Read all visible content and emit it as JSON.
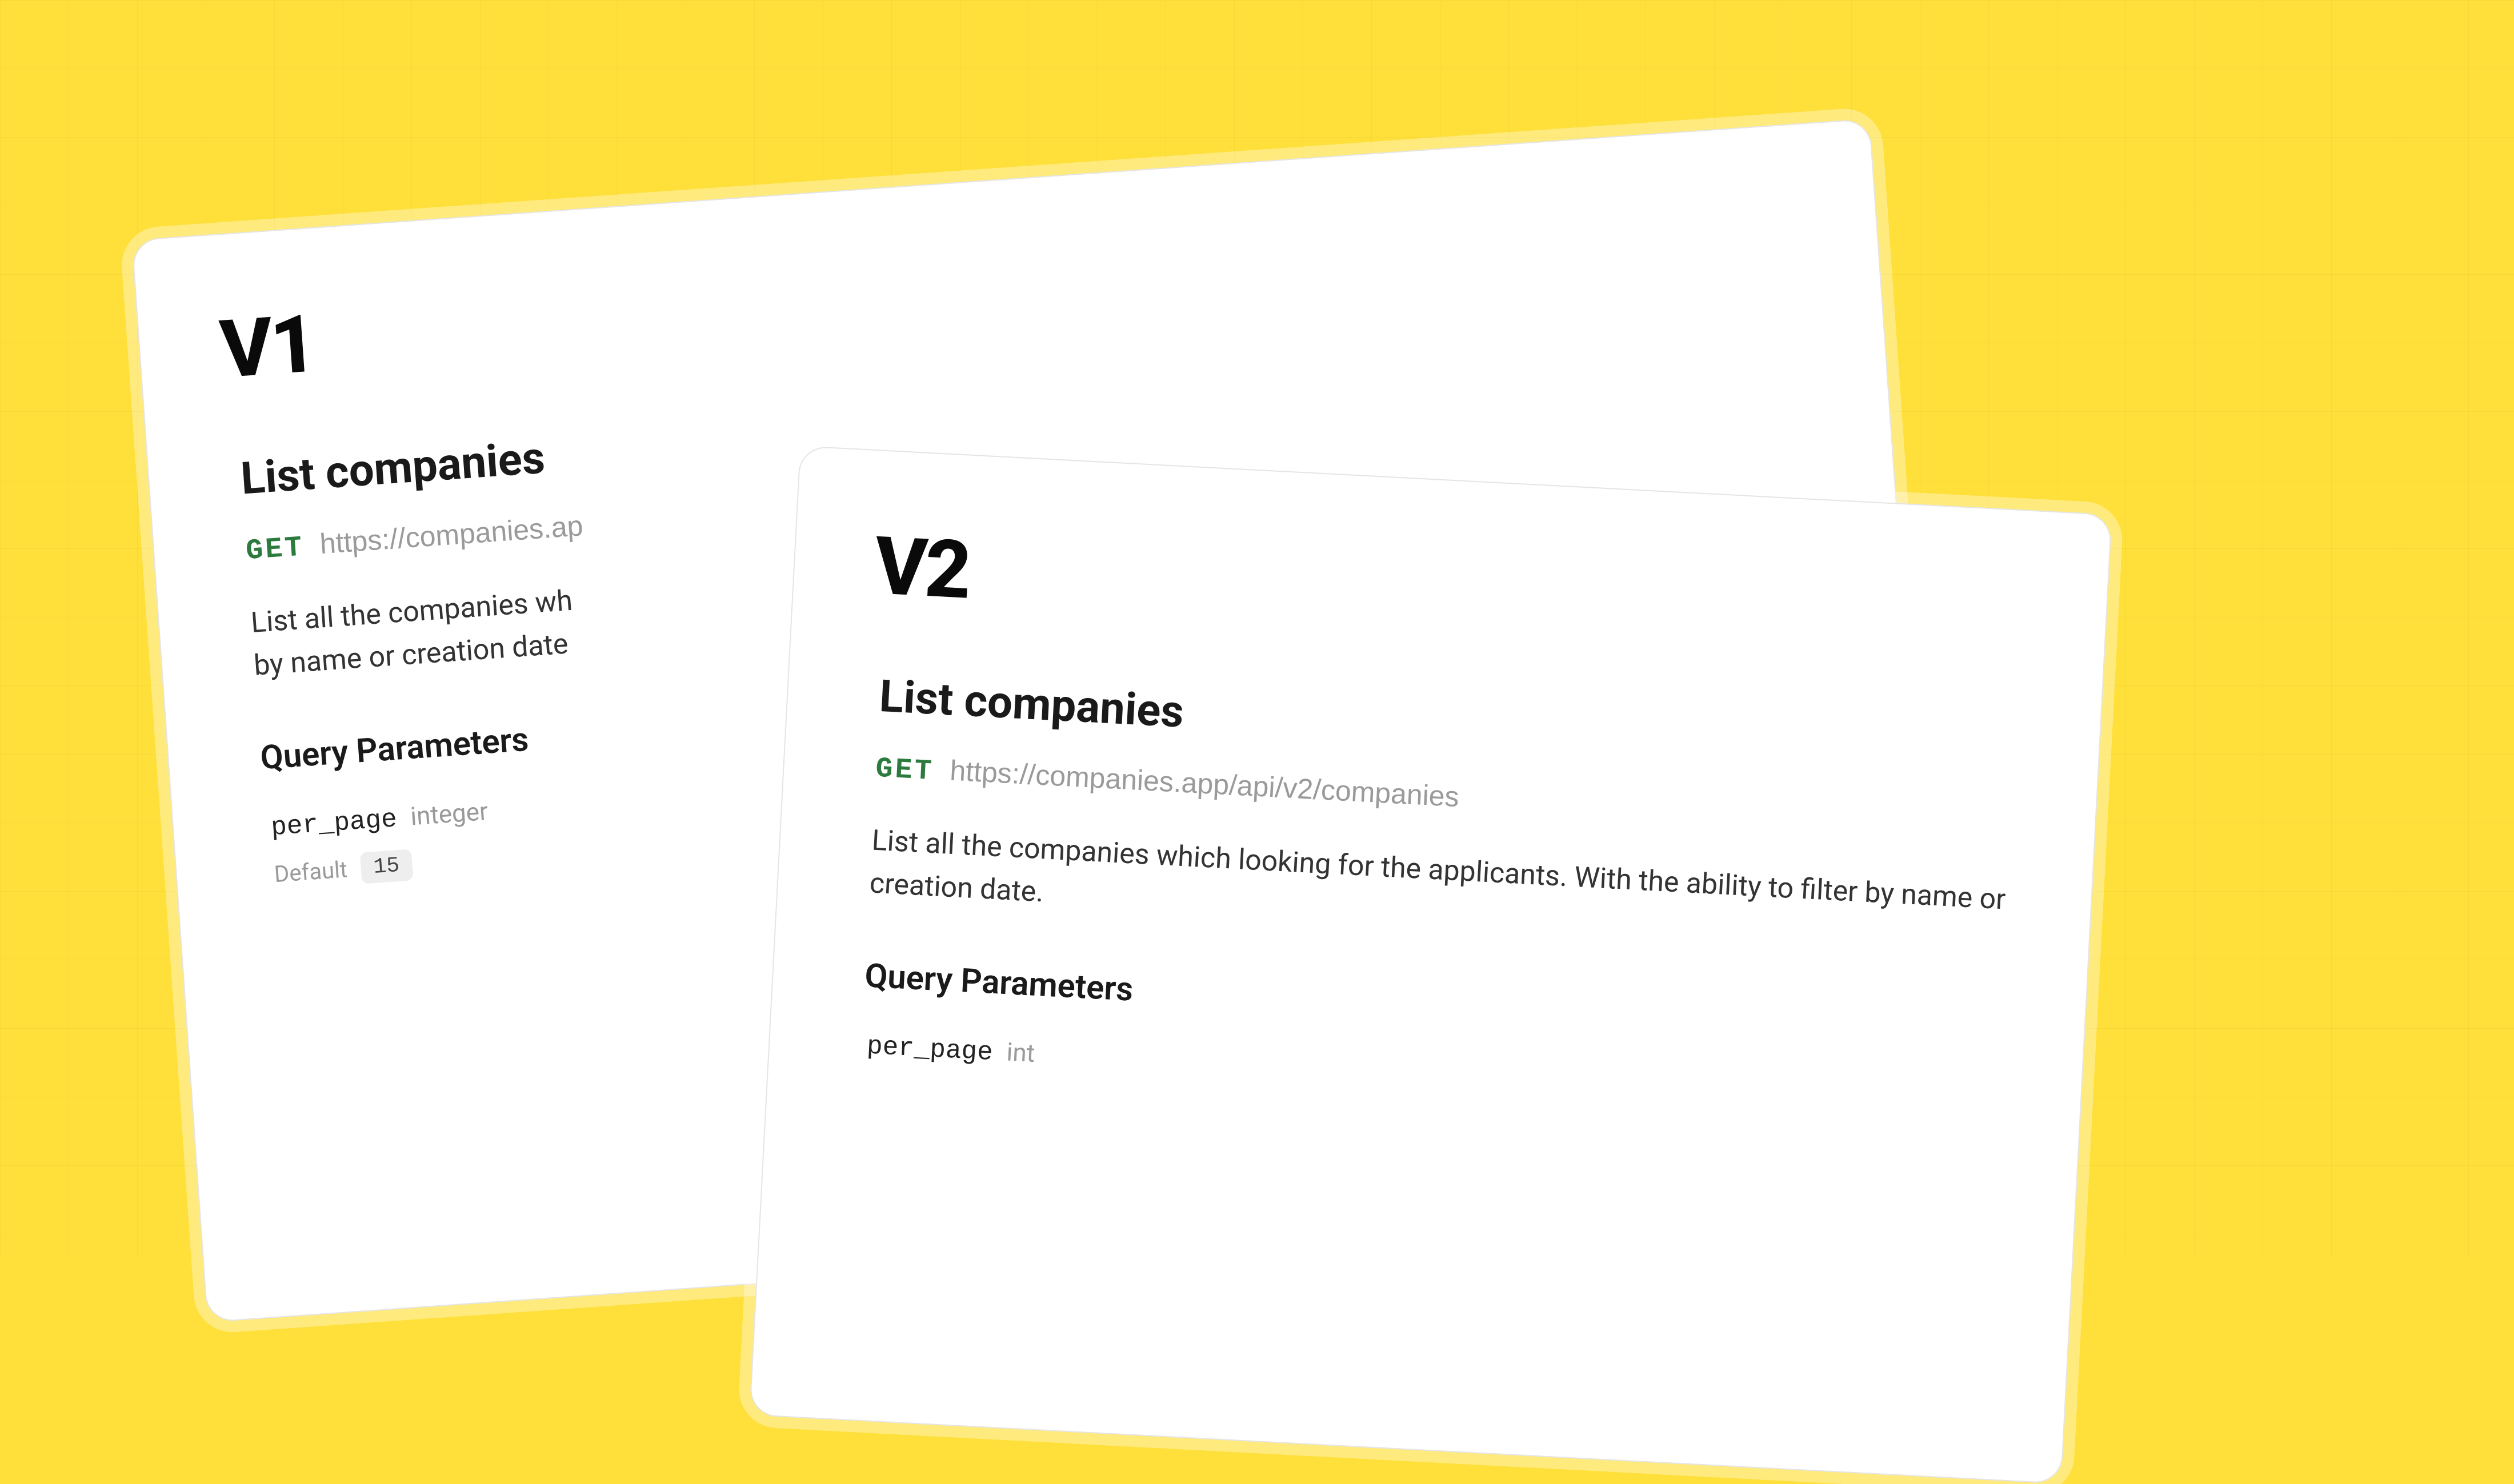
{
  "v1": {
    "version_label": "V1",
    "title": "List companies",
    "method": "GET",
    "url": "https://companies.ap",
    "description_line1": "List all the companies wh",
    "description_line2": "by name or creation date",
    "section": "Query Parameters",
    "params": {
      "name": "per_page",
      "type": "integer",
      "default_label": "Default",
      "default_value": "15"
    }
  },
  "v2": {
    "version_label": "V2",
    "title": "List companies",
    "method": "GET",
    "url": "https://companies.app/api/v2/companies",
    "description": "List all the companies which looking for the applicants. With the ability to filter by name or creation date.",
    "section": "Query Parameters",
    "params": {
      "name": "per_page",
      "type": "int"
    }
  }
}
